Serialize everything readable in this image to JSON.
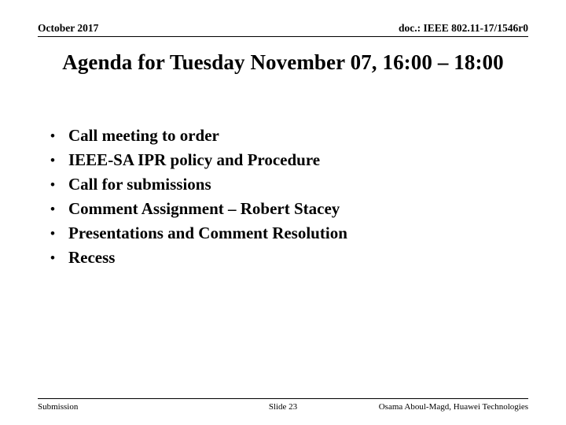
{
  "slide": {
    "header": {
      "date": "October 2017",
      "document_id": "doc.: IEEE 802.11-17/1546r0"
    },
    "title": "Agenda for Tuesday November 07, 16:00 – 18:00",
    "bullet_marker": "•",
    "bullets": [
      {
        "text": "Call meeting to order"
      },
      {
        "text": "IEEE-SA IPR policy and Procedure"
      },
      {
        "text": "Call for submissions"
      },
      {
        "text": "Comment Assignment – Robert Stacey"
      },
      {
        "text": "Presentations and Comment Resolution"
      },
      {
        "text": "Recess"
      }
    ],
    "footer": {
      "left": "Submission",
      "center": "Slide 23",
      "right": "Osama Aboul-Magd, Huawei Technologies"
    }
  }
}
